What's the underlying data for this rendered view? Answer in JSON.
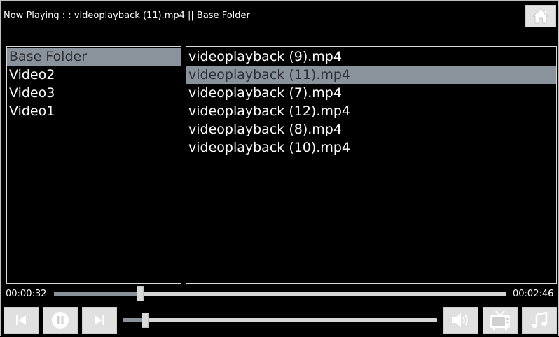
{
  "header": {
    "now_playing": "Now Playing : : videoplayback (11).mp4 || Base Folder"
  },
  "folders": [
    {
      "label": "Base Folder",
      "selected": true
    },
    {
      "label": "Video2",
      "selected": false
    },
    {
      "label": "Video3",
      "selected": false
    },
    {
      "label": "Video1",
      "selected": false
    }
  ],
  "files": [
    {
      "label": "videoplayback (9).mp4",
      "selected": false
    },
    {
      "label": "videoplayback (11).mp4",
      "selected": true
    },
    {
      "label": "videoplayback (7).mp4",
      "selected": false
    },
    {
      "label": "videoplayback (12).mp4",
      "selected": false
    },
    {
      "label": "videoplayback (8).mp4",
      "selected": false
    },
    {
      "label": "videoplayback (10).mp4",
      "selected": false
    }
  ],
  "playback": {
    "elapsed": "00:00:32",
    "duration": "00:02:46",
    "progress_fraction": 0.19
  },
  "volume": {
    "level_fraction": 0.07
  },
  "icons": {
    "home": "home-icon",
    "previous": "skip-previous-icon",
    "pause": "pause-icon",
    "next": "skip-next-icon",
    "volume": "volume-icon",
    "tv": "tv-icon",
    "music": "music-note-icon"
  },
  "colors": {
    "selection": "#8a939b",
    "button_bg": "#e0e0e0",
    "track": "#d6d6d6"
  }
}
